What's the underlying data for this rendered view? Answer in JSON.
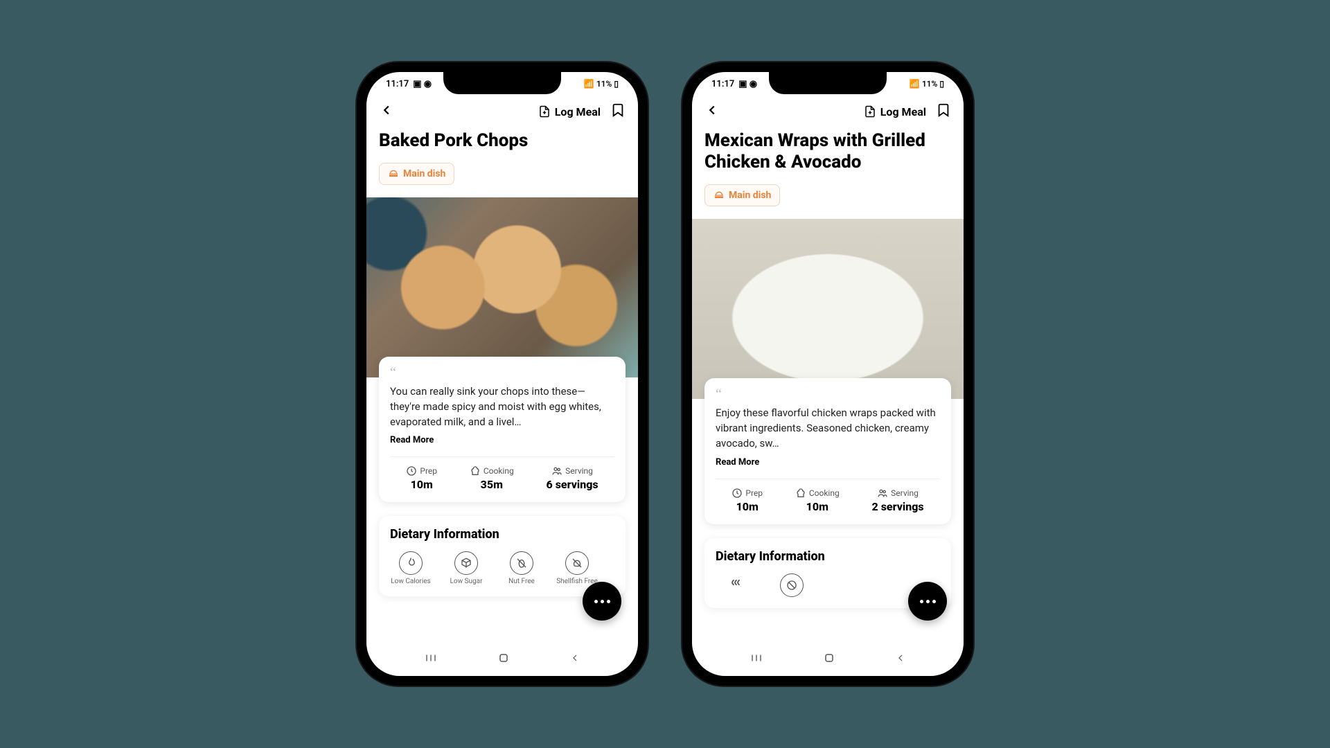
{
  "status": {
    "time": "11:17",
    "battery": "11%"
  },
  "topbar": {
    "log_meal": "Log Meal"
  },
  "tag": {
    "label": "Main dish"
  },
  "readmore": "Read More",
  "stats_labels": {
    "prep": "Prep",
    "cooking": "Cooking",
    "serving": "Serving"
  },
  "dietary_title": "Dietary Information",
  "phones": [
    {
      "title": "Baked Pork Chops",
      "description": "You can really sink your chops into these—they're made spicy and moist with egg whites, evaporated milk, and a livel…",
      "prep": "10m",
      "cooking": "35m",
      "serving": "6 servings",
      "dietary": [
        "Low Calories",
        "Low Sugar",
        "Nut Free",
        "Shellfish Free"
      ],
      "img": "pork"
    },
    {
      "title": "Mexican Wraps with Grilled Chicken & Avocado",
      "description": "Enjoy these flavorful chicken wraps packed with vibrant ingredients. Seasoned chicken, creamy avocado, sw…",
      "prep": "10m",
      "cooking": "10m",
      "serving": "2 servings",
      "dietary": [],
      "img": "wraps"
    }
  ]
}
